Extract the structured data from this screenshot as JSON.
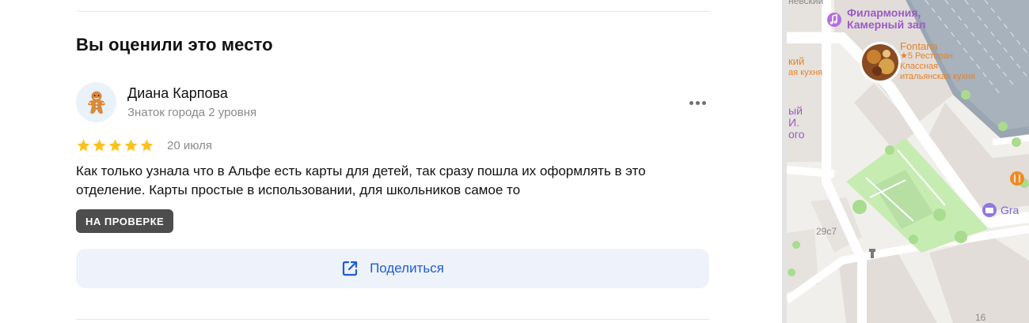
{
  "review_section": {
    "title": "Вы оценили это место",
    "author": {
      "name": "Диана Карпова",
      "level": "Знаток города 2 уровня",
      "avatar_icon": "gingerbread-man-icon"
    },
    "rating": 5,
    "rating_max": 5,
    "date": "20 июля",
    "text": "Как только узнала что в Альфе есть карты для детей, так сразу пошла их оформлять в это отделение. Карты простые в использовании, для школьников самое то",
    "status_badge": "НА ПРОВЕРКЕ",
    "share_button": {
      "label": "Поделиться",
      "icon": "share-icon"
    },
    "more_button_icon": "more-dots-icon"
  },
  "map": {
    "labels": {
      "top_left_fragment": "невский",
      "philharmonia_line1": "Филармония,",
      "philharmonia_line2": "Камерный зал",
      "restaurant_name": "Fontana",
      "restaurant_rating_type": "★5 Ресторан",
      "restaurant_cuisine_line1": "Классная",
      "restaurant_cuisine_line2": "итальянская кухня",
      "left_poi_line1": "кий",
      "left_poi_line2": "ая кухня",
      "left_street_line1": "ый",
      "left_street_line2": "И.",
      "left_street_line3": "ого",
      "building_number": "29с7",
      "bottom_number": "16",
      "gra_fragment": "Gra"
    },
    "colors": {
      "park": "#c7ecb2",
      "road": "#ffffff",
      "building": "#e4e0dc",
      "philharmonia_icon": "#b46fe0",
      "restaurant_accent": "#f08a24",
      "label_purple": "#9a5bc8",
      "label_orange": "#e5822a"
    }
  },
  "colors": {
    "star": "#fcc11c",
    "badge_bg": "#4d4d4d",
    "share_bg": "#eef3fb",
    "share_text": "#1f5bd6"
  }
}
